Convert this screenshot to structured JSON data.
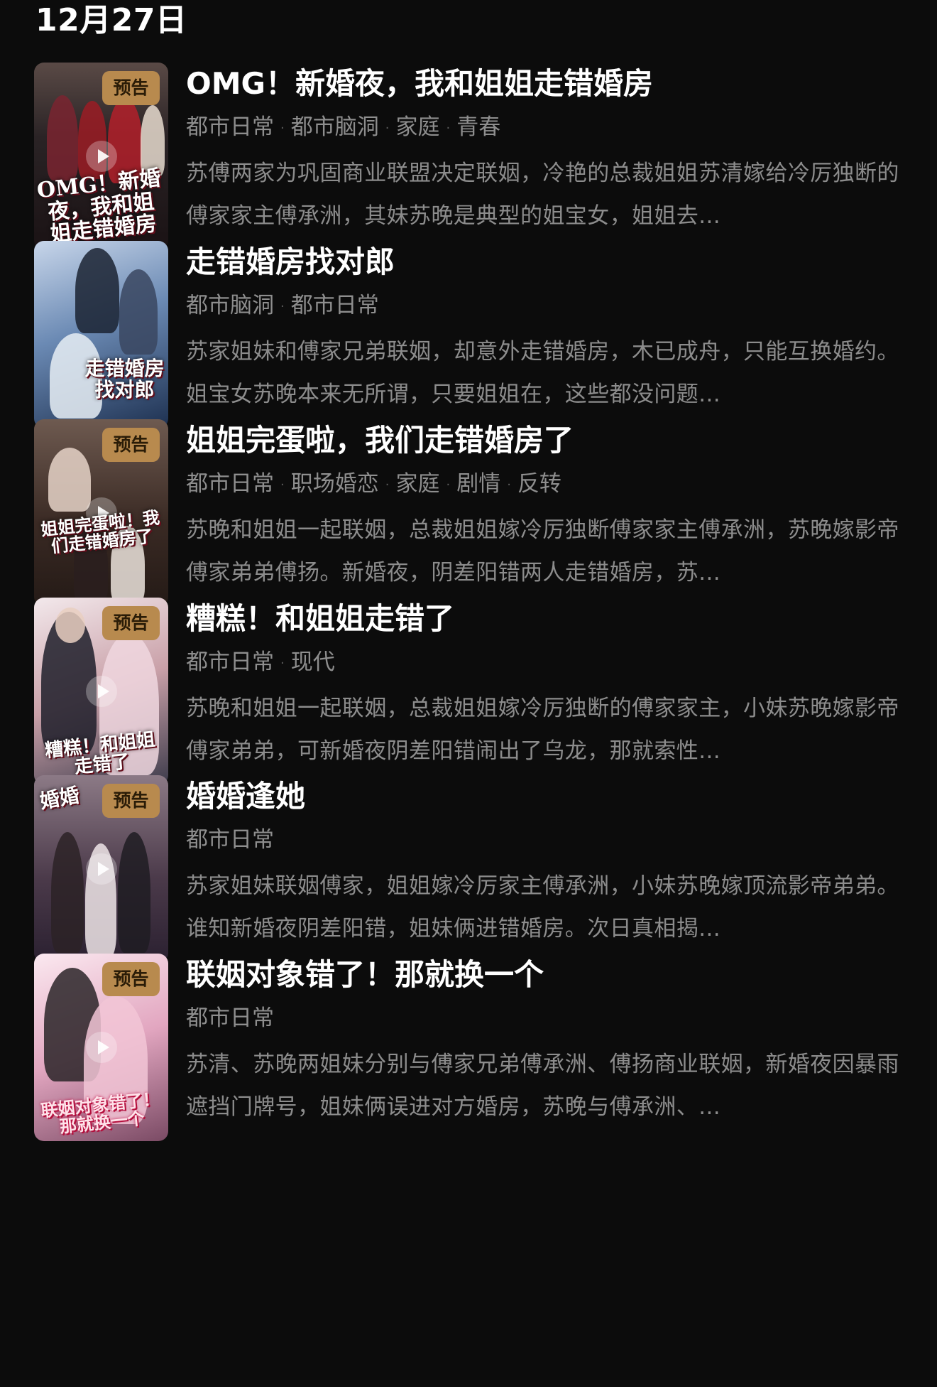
{
  "header": {
    "date": "12月27日"
  },
  "shows": [
    {
      "badge": "预告",
      "title": "OMG！新婚夜，我和姐姐走错婚房",
      "tags": [
        "都市日常",
        "都市脑洞",
        "家庭",
        "青春"
      ],
      "description": "苏傅两家为巩固商业联盟决定联姻，冷艳的总裁姐姐苏清嫁给冷厉独断的傅家家主傅承洲，其妹苏晚是典型的姐宝女，姐姐去...",
      "cover_text": "OMG！新婚夜，我和姐姐走错婚房",
      "cover_colors": [
        "#2a2325",
        "#8b1c22",
        "#c9b9a8"
      ]
    },
    {
      "badge": "",
      "title": "走错婚房找对郎",
      "tags": [
        "都市脑洞",
        "都市日常"
      ],
      "description": "苏家姐妹和傅家兄弟联姻，却意外走错婚房，木已成舟，只能互换婚约。姐宝女苏晚本来无所谓，只要姐姐在，这些都没问题...",
      "cover_text": "走错婚房找对郎",
      "cover_colors": [
        "#1d3050",
        "#6b8ab4",
        "#e6eef7"
      ]
    },
    {
      "badge": "预告",
      "title": "姐姐完蛋啦，我们走错婚房了",
      "tags": [
        "都市日常",
        "职场婚恋",
        "家庭",
        "剧情",
        "反转"
      ],
      "description": "苏晚和姐姐一起联姻，总裁姐姐嫁冷厉独断傅家家主傅承洲，苏晚嫁影帝傅家弟弟傅扬。新婚夜，阴差阳错两人走错婚房，苏...",
      "cover_text": "姐姐完蛋啦！我们走错婚房了",
      "cover_colors": [
        "#3a2a24",
        "#7b5b4b",
        "#d7c3b3"
      ]
    },
    {
      "badge": "预告",
      "title": "糟糕！和姐姐走错了",
      "tags": [
        "都市日常",
        "现代"
      ],
      "description": "苏晚和姐姐一起联姻，总裁姐姐嫁冷厉独断的傅家家主，小妹苏晚嫁影帝傅家弟弟，可新婚夜阴差阳错闹出了乌龙，那就索性...",
      "cover_text": "糟糕！和姐姐走错了",
      "cover_colors": [
        "#3b3a4a",
        "#c9a0a8",
        "#f1e7ea"
      ]
    },
    {
      "badge": "预告",
      "title": "婚婚逢她",
      "tags": [
        "都市日常"
      ],
      "description": "苏家姐妹联姻傅家，姐姐嫁冷厉家主傅承洲，小妹苏晚嫁顶流影帝弟弟。谁知新婚夜阴差阳错，姐妹俩进错婚房。次日真相揭...",
      "cover_text": "婚婚",
      "cover_colors": [
        "#4b3a4a",
        "#9a7f8c",
        "#d9cbd2"
      ]
    },
    {
      "badge": "预告",
      "title": "联姻对象错了！那就换一个",
      "tags": [
        "都市日常"
      ],
      "description": "苏清、苏晚两姐妹分别与傅家兄弟傅承洲、傅扬商业联姻，新婚夜因暴雨遮挡门牌号，姐妹俩误进对方婚房，苏晚与傅承洲、...",
      "cover_text": "联姻对象错了！那就换一个",
      "cover_colors": [
        "#7a4a64",
        "#e2a6c0",
        "#f8e6ee"
      ]
    }
  ]
}
